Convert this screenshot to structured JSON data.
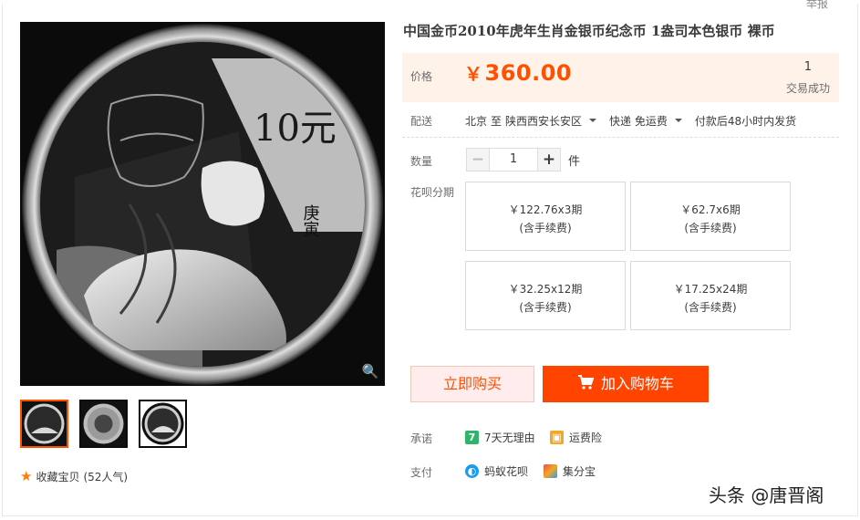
{
  "report_link": "举报",
  "product": {
    "title": "中国金币2010年虎年生肖金银币纪念币 1盎司本色银币 裸币",
    "coin_text": "10元",
    "coin_year": "庚寅"
  },
  "price": {
    "label": "价格",
    "currency": "￥",
    "amount": "360.00",
    "sold_count": "1",
    "sold_label": "交易成功"
  },
  "shipping": {
    "label": "配送",
    "from": "北京",
    "to_word": "至",
    "destination": "陕西西安长安区",
    "method": "快递 免运费",
    "dispatch": "付款后48小时内发货"
  },
  "quantity": {
    "label": "数量",
    "minus": "−",
    "value": "1",
    "plus": "+",
    "unit": "件"
  },
  "installments": {
    "label": "花呗分期",
    "options": [
      {
        "price": "￥122.76x3期",
        "note": "(含手续费)"
      },
      {
        "price": "￥62.7x6期",
        "note": "(含手续费)"
      },
      {
        "price": "￥32.25x12期",
        "note": "(含手续费)"
      },
      {
        "price": "￥17.25x24期",
        "note": "(含手续费)"
      }
    ]
  },
  "actions": {
    "buy_now": "立即购买",
    "add_to_cart": "加入购物车"
  },
  "promise": {
    "label": "承诺",
    "items": [
      {
        "icon": "7",
        "text": "7天无理由"
      },
      {
        "icon": "insurance-icon",
        "text": "运费险"
      }
    ]
  },
  "payment": {
    "label": "支付",
    "items": [
      {
        "icon": "ant-huabei-icon",
        "text": "蚂蚁花呗"
      },
      {
        "icon": "jifenbao-icon",
        "text": "集分宝"
      }
    ]
  },
  "favorite": {
    "label": "收藏宝贝",
    "count": "(52人气)"
  },
  "watermark": "头条 @唐晋阁",
  "colors": {
    "accent": "#ff5000",
    "cart_button": "#ff4400",
    "price_bg": "#fff2e8"
  }
}
